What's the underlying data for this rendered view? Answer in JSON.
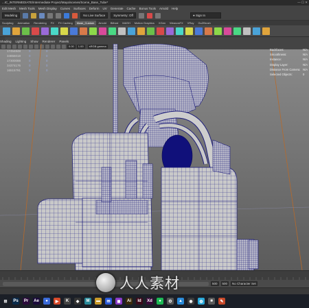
{
  "window": {
    "title": "...IC_INTERMEDIATE/Intermediate Project/Maya/scenes/Scene_Base_Tube*",
    "controls": "—  ☐  ✕"
  },
  "menubar": {
    "items": [
      "Edit Mesh",
      "Mesh Tools",
      "Mesh Display",
      "Curves",
      "Surfaces",
      "Deform",
      "UV",
      "Generate",
      "Cache",
      "Bonus Tools",
      "Arnold",
      "Help"
    ]
  },
  "statusline": {
    "mode": "Modeling",
    "live_surface": "No Live Surface",
    "symmetry": "Symmetry: Off",
    "sign_in": "Sign In"
  },
  "shelf": {
    "tabs": [
      "Sculpting",
      "Animation",
      "Rendering",
      "FX",
      "FX Caching",
      "Mask_Custom",
      "Arnold",
      "Bifrost",
      "MASH",
      "Motion Graphics",
      "XGen",
      "WeavosFX",
      "VRay",
      "GoZBrush"
    ],
    "active_tab": "Mask_Custom",
    "icon_colors": [
      "#4aa3d8",
      "#e0a43c",
      "#6cc04a",
      "#d84a4a",
      "#9a6ad8",
      "#4ad8c8",
      "#d8d84a",
      "#4a7ad8",
      "#d87a4a",
      "#8cd84a",
      "#d84a9a",
      "#4ad884",
      "#c0c0c0",
      "#4aa3d8",
      "#e0a43c",
      "#6cc04a",
      "#d84a4a",
      "#9a6ad8",
      "#4ad8c8",
      "#d8d84a",
      "#4a7ad8",
      "#d87a4a",
      "#8cd84a",
      "#d84a9a",
      "#4ad884",
      "#c0c0c0",
      "#4aa3d8",
      "#e0a43c"
    ]
  },
  "outliner": {
    "rows": [
      {
        "label": "17454848",
        "a": "0",
        "b": "0"
      },
      {
        "label": "34856018",
        "a": "0",
        "b": "0"
      },
      {
        "label": "17300088",
        "a": "0",
        "b": "0"
      },
      {
        "label": "34374176",
        "a": "0",
        "b": "0"
      },
      {
        "label": "16515791",
        "a": "0",
        "b": "0"
      }
    ]
  },
  "viewport_menu": [
    "Shading",
    "Lighting",
    "Show",
    "Renderer",
    "Panels"
  ],
  "viewport_toolbar": {
    "field1": "0.00",
    "field2": "1.00",
    "colorspace": "sRGB gamma"
  },
  "hud": {
    "rows": [
      {
        "k": "Backfaces:",
        "v": "N/A"
      },
      {
        "k": "Smoothness:",
        "v": "N/A"
      },
      {
        "k": "Instance:",
        "v": "N/A"
      },
      {
        "k": "Display Layer:",
        "v": "N/A"
      },
      {
        "k": "Distance From Camera:",
        "v": "N/A"
      },
      {
        "k": "Selected Objects:",
        "v": "0"
      }
    ]
  },
  "range": {
    "start_a": "500",
    "start_b": "500",
    "character_set": "No Character Set"
  },
  "taskbar": {
    "icons": [
      {
        "name": "start-icon",
        "glyph": "⊞",
        "color": "#1b1f27"
      },
      {
        "name": "photoshop-icon",
        "glyph": "Ps",
        "color": "#0a2a4a"
      },
      {
        "name": "premiere-icon",
        "glyph": "Pr",
        "color": "#2a0a3a"
      },
      {
        "name": "after-effects-icon",
        "glyph": "Ae",
        "color": "#1a0a3a"
      },
      {
        "name": "chrome-icon",
        "glyph": "●",
        "color": "#3a6ad8"
      },
      {
        "name": "media-icon",
        "glyph": "▶",
        "color": "#d84a2a"
      },
      {
        "name": "k-app-icon",
        "glyph": "K",
        "color": "#444444"
      },
      {
        "name": "unity-icon",
        "glyph": "◆",
        "color": "#333333"
      },
      {
        "name": "maya-icon",
        "glyph": "M",
        "color": "#2a8a9a"
      },
      {
        "name": "folder-icon",
        "glyph": "▬",
        "color": "#c89a2a"
      },
      {
        "name": "mail-icon",
        "glyph": "✉",
        "color": "#2a5ad8"
      },
      {
        "name": "cube-icon",
        "glyph": "◼",
        "color": "#8a3ac8"
      },
      {
        "name": "illustrator-icon",
        "glyph": "Ai",
        "color": "#3a2a0a"
      },
      {
        "name": "id-icon",
        "glyph": "Id",
        "color": "#3a0a1a"
      },
      {
        "name": "xd-icon",
        "glyph": "Xd",
        "color": "#3a0a3a"
      },
      {
        "name": "spotify-icon",
        "glyph": "●",
        "color": "#1db954"
      },
      {
        "name": "settings-icon",
        "glyph": "⚙",
        "color": "#555555"
      },
      {
        "name": "app1-icon",
        "glyph": "▲",
        "color": "#2a8ad8"
      },
      {
        "name": "app2-icon",
        "glyph": "◉",
        "color": "#3a3a3a"
      },
      {
        "name": "app3-icon",
        "glyph": "◍",
        "color": "#2aa8d8"
      },
      {
        "name": "app4-icon",
        "glyph": "■",
        "color": "#5a5a5a"
      },
      {
        "name": "app5-icon",
        "glyph": "✎",
        "color": "#c84a2a"
      }
    ]
  },
  "watermark": {
    "text": "人人素材"
  },
  "colors": {
    "wire": "#1c1c7a",
    "mesh": "#c8c8c8",
    "background": "#7a7a7a"
  }
}
